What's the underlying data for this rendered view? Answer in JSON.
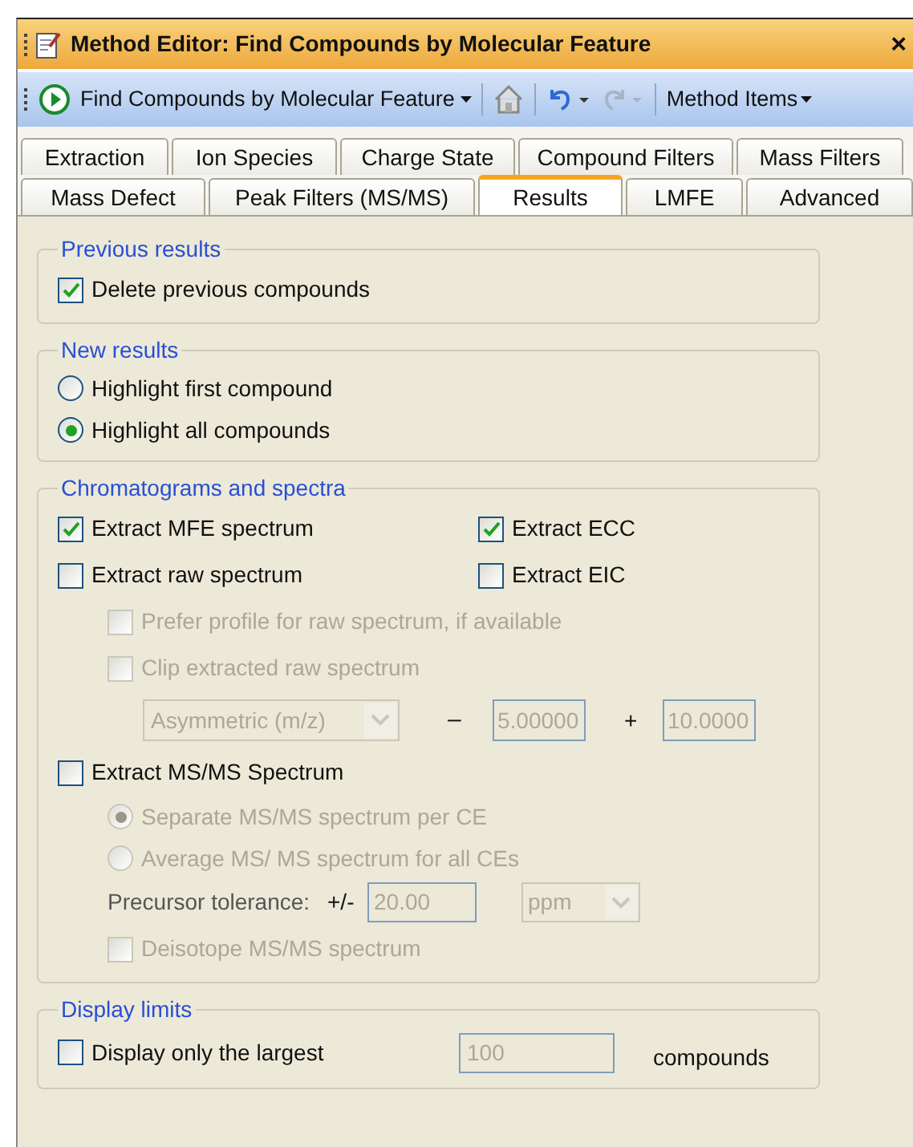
{
  "window": {
    "title": "Method Editor: Find Compounds by Molecular Feature",
    "close_glyph": "×"
  },
  "toolbar": {
    "method_button": "Find Compounds by Molecular Feature",
    "method_items": "Method Items"
  },
  "tab_rows": [
    [
      {
        "label": "Extraction",
        "selected": false
      },
      {
        "label": "Ion Species",
        "selected": false
      },
      {
        "label": "Charge State",
        "selected": false
      },
      {
        "label": "Compound Filters",
        "selected": false
      },
      {
        "label": "Mass Filters",
        "selected": false
      }
    ],
    [
      {
        "label": "Mass Defect",
        "selected": false
      },
      {
        "label": "Peak Filters (MS/MS)",
        "selected": false
      },
      {
        "label": "Results",
        "selected": true
      },
      {
        "label": "LMFE",
        "selected": false
      },
      {
        "label": "Advanced",
        "selected": false
      }
    ]
  ],
  "groups": [
    {
      "title": "Previous results",
      "items": [
        {
          "kind": "checkbox",
          "label": "Delete previous compounds",
          "checked": true,
          "disabled": false
        }
      ]
    },
    {
      "title": "New results",
      "items": [
        {
          "kind": "radio",
          "label": "Highlight first compound",
          "selected": false,
          "disabled": false
        },
        {
          "kind": "radio",
          "label": "Highlight all compounds",
          "selected": true,
          "disabled": false
        }
      ]
    },
    {
      "title": "Chromatograms and spectra",
      "items": [
        {
          "kind": "checkbox",
          "label": "Extract MFE spectrum",
          "checked": true,
          "disabled": false,
          "beside": {
            "label": "Extract ECC",
            "checked": true
          }
        },
        {
          "kind": "checkbox",
          "label": "Extract raw spectrum",
          "checked": false,
          "disabled": false,
          "beside": {
            "label": "Extract EIC",
            "checked": false
          },
          "children": [
            {
              "kind": "checkbox",
              "label": "Prefer profile for raw spectrum, if available",
              "checked": false,
              "disabled": true
            },
            {
              "kind": "checkbox",
              "label": "Clip extracted raw spectrum",
              "checked": false,
              "disabled": true
            },
            {
              "kind": "range",
              "dropdown": "Asymmetric (m/z)",
              "minus": "–",
              "low": "5.00000",
              "plus": "+",
              "high": "10.0000",
              "disabled": true
            }
          ]
        },
        {
          "kind": "checkbox",
          "label": "Extract MS/MS Spectrum",
          "checked": false,
          "disabled": false,
          "children": [
            {
              "kind": "radio",
              "label": "Separate MS/MS spectrum per CE",
              "selected": true,
              "disabled": true
            },
            {
              "kind": "radio",
              "label": "Average MS/ MS spectrum for all CEs",
              "selected": false,
              "disabled": true
            },
            {
              "kind": "tolerance",
              "label": "Precursor tolerance:",
              "sign": "+/-",
              "value": "20.00",
              "unit": "ppm",
              "disabled": true
            },
            {
              "kind": "checkbox",
              "label": "Deisotope MS/MS spectrum",
              "checked": false,
              "disabled": true
            }
          ]
        }
      ]
    },
    {
      "title": "Display limits",
      "items": [
        {
          "kind": "limit",
          "label": "Display only the largest",
          "checked": false,
          "disabled": false,
          "value": "100",
          "suffix": "compounds"
        }
      ]
    }
  ]
}
